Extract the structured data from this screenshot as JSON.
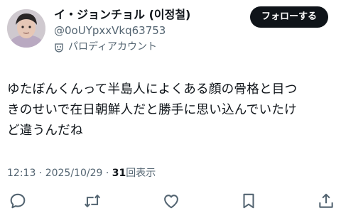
{
  "post": {
    "author": {
      "display_name": "イ・ジョンチョル (이정철)",
      "handle": "@0oUYpxxVkq63753",
      "account_label": "パロディアカウント",
      "label_icon": "mask-icon"
    },
    "follow_label": "フォローする",
    "text_lines": [
      "ゆたぼんくんって半島人によくある顔の骨格と目つ",
      "きのせいで在日朝鮮人だと勝手に思い込んでいたけ",
      "ど違うんだね"
    ],
    "timestamp": "12:13 · 2025/10/29 · ",
    "views_count": "31",
    "views_label": "回表示",
    "actions": [
      {
        "name": "reply",
        "icon": "reply-icon"
      },
      {
        "name": "repost",
        "icon": "repost-icon"
      },
      {
        "name": "like",
        "icon": "heart-icon"
      },
      {
        "name": "bookmark",
        "icon": "bookmark-icon"
      },
      {
        "name": "share",
        "icon": "share-icon"
      }
    ],
    "colors": {
      "text": "#0f1419",
      "secondary": "#536471",
      "button_bg": "#0f1419",
      "button_text": "#ffffff"
    }
  }
}
